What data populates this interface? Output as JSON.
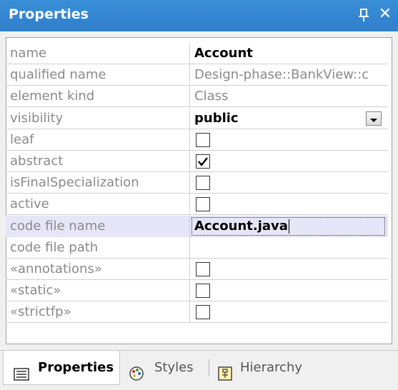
{
  "window": {
    "title": "Properties"
  },
  "properties": [
    {
      "name": "name",
      "value": "Account",
      "kind": "text-bold"
    },
    {
      "name": "qualified name",
      "value": "Design-phase::BankView::c",
      "kind": "text-grey"
    },
    {
      "name": "element kind",
      "value": "Class",
      "kind": "text-grey"
    },
    {
      "name": "visibility",
      "value": "public",
      "kind": "dropdown"
    },
    {
      "name": "leaf",
      "checked": false,
      "kind": "checkbox"
    },
    {
      "name": "abstract",
      "checked": true,
      "kind": "checkbox"
    },
    {
      "name": "isFinalSpecialization",
      "checked": false,
      "kind": "checkbox"
    },
    {
      "name": "active",
      "checked": false,
      "kind": "checkbox"
    },
    {
      "name": "code file name",
      "value": "Account.java",
      "kind": "editing"
    },
    {
      "name": "code file path",
      "value": "",
      "kind": "text"
    },
    {
      "name": "«annotations»",
      "checked": false,
      "kind": "checkbox"
    },
    {
      "name": "«static»",
      "checked": false,
      "kind": "checkbox"
    },
    {
      "name": "«strictfp»",
      "checked": false,
      "kind": "checkbox"
    }
  ],
  "tabs": [
    {
      "label": "Properties",
      "icon": "properties-icon",
      "active": true
    },
    {
      "label": "Styles",
      "icon": "palette-icon",
      "active": false
    },
    {
      "label": "Hierarchy",
      "icon": "hierarchy-icon",
      "active": false
    }
  ],
  "colors": {
    "titlebar": "#3a8ed8",
    "selected_row": "#e6e6f8",
    "label_text": "#8a8a8a"
  }
}
